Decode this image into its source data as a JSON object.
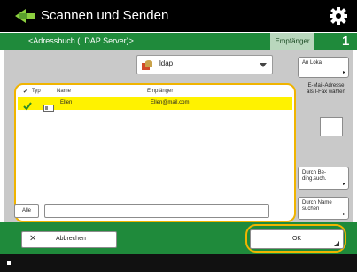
{
  "titlebar": {
    "title": "Scannen und Senden",
    "icon": "scan-send-icon",
    "settings_icon": "gear-icon"
  },
  "subbar": {
    "address_book": "<Adressbuch (LDAP Server)>",
    "recipient_tab": "Empfänger",
    "recipient_count": "1"
  },
  "dropdown": {
    "value": "ldap",
    "icon": "database-icon"
  },
  "list": {
    "headers": {
      "typ": "Typ",
      "name": "Name",
      "empfaenger": "Empfänger"
    },
    "rows": [
      {
        "name": "Ellen",
        "recipient": "Ellen@mail.com",
        "selected": true
      }
    ]
  },
  "side_buttons": {
    "an_lokal": "An Lokal",
    "email_select": "E-Mail-Adresse als I-Fax wählen",
    "by_condition": "Durch Be-ding.such.",
    "by_name": "Durch Name suchen"
  },
  "filter": {
    "alle": "Alle",
    "placeholder": ""
  },
  "actions": {
    "cancel": "Abbrechen",
    "ok": "OK"
  },
  "colors": {
    "green": "#1f8a3b",
    "highlight_orange": "#f0b400",
    "selected_yellow": "#fff200",
    "panel_gray": "#c9c9c9"
  }
}
